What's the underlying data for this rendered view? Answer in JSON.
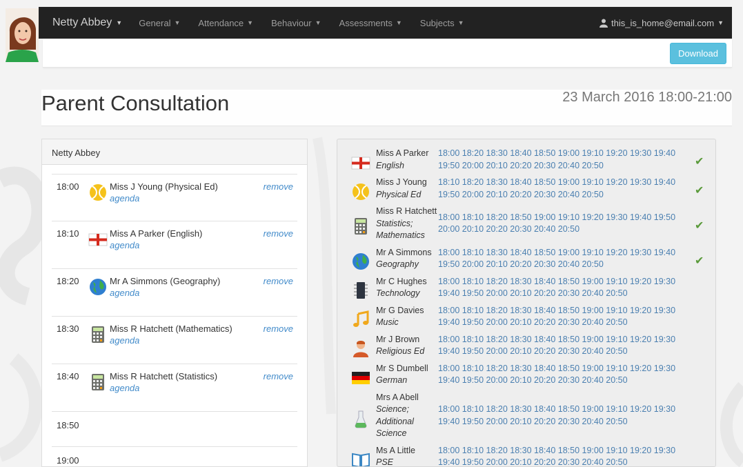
{
  "nav": {
    "brand": "Netty Abbey",
    "items": [
      "General",
      "Attendance",
      "Behaviour",
      "Assessments",
      "Subjects"
    ],
    "user": "this_is_home@email.com"
  },
  "toolbar": {
    "download_label": "Download"
  },
  "header": {
    "title": "Parent Consultation",
    "date": "23 March 2016 18:00-21:00"
  },
  "schedule": {
    "student": "Netty Abbey",
    "agenda_label": "agenda",
    "remove_label": "remove",
    "slots": [
      {
        "time": "18:00",
        "teacher": "Miss J Young (Physical Ed)",
        "icon": "tennis-ball-icon"
      },
      {
        "time": "18:10",
        "teacher": "Miss A Parker (English)",
        "icon": "england-flag-icon"
      },
      {
        "time": "18:20",
        "teacher": "Mr A Simmons (Geography)",
        "icon": "globe-icon"
      },
      {
        "time": "18:30",
        "teacher": "Miss R Hatchett (Mathematics)",
        "icon": "calculator-icon"
      },
      {
        "time": "18:40",
        "teacher": "Miss R Hatchett (Statistics)",
        "icon": "calculator-icon"
      },
      {
        "time": "18:50"
      },
      {
        "time": "19:00"
      }
    ]
  },
  "teachers": [
    {
      "name": "Miss A Parker",
      "subject": [
        "English"
      ],
      "slots": [
        "18:00 18:20 18:30 18:40 18:50 19:00 19:10 19:20 19:30 19:40",
        "19:50 20:00 20:10 20:20 20:30 20:40 20:50"
      ],
      "booked": true,
      "icon": "england-flag-icon"
    },
    {
      "name": "Miss J Young",
      "subject": [
        "Physical Ed"
      ],
      "slots": [
        "18:10 18:20 18:30 18:40 18:50 19:00 19:10 19:20 19:30 19:40",
        "19:50 20:00 20:10 20:20 20:30 20:40 20:50"
      ],
      "booked": true,
      "icon": "tennis-ball-icon"
    },
    {
      "name": "Miss R Hatchett",
      "subject": [
        "Statistics;",
        "Mathematics"
      ],
      "slots": [
        "18:00 18:10 18:20 18:50 19:00 19:10 19:20 19:30 19:40 19:50",
        "20:00 20:10 20:20 20:30 20:40 20:50"
      ],
      "booked": true,
      "icon": "calculator-icon"
    },
    {
      "name": "Mr A Simmons",
      "subject": [
        "Geography"
      ],
      "slots": [
        "18:00 18:10 18:30 18:40 18:50 19:00 19:10 19:20 19:30 19:40",
        "19:50 20:00 20:10 20:20 20:30 20:40 20:50"
      ],
      "booked": true,
      "icon": "globe-icon"
    },
    {
      "name": "Mr C Hughes",
      "subject": [
        "Technology"
      ],
      "slots": [
        "18:00 18:10 18:20 18:30 18:40 18:50 19:00 19:10 19:20 19:30",
        "19:40 19:50 20:00 20:10 20:20 20:30 20:40 20:50"
      ],
      "booked": false,
      "icon": "chip-icon"
    },
    {
      "name": "Mr G Davies",
      "subject": [
        "Music"
      ],
      "slots": [
        "18:00 18:10 18:20 18:30 18:40 18:50 19:00 19:10 19:20 19:30",
        "19:40 19:50 20:00 20:10 20:20 20:30 20:40 20:50"
      ],
      "booked": false,
      "icon": "music-note-icon"
    },
    {
      "name": "Mr J Brown",
      "subject": [
        "Religious Ed"
      ],
      "slots": [
        "18:00 18:10 18:20 18:30 18:40 18:50 19:00 19:10 19:20 19:30",
        "19:40 19:50 20:00 20:10 20:20 20:30 20:40 20:50"
      ],
      "booked": false,
      "icon": "person-icon"
    },
    {
      "name": "Mr S Dumbell",
      "subject": [
        "German"
      ],
      "slots": [
        "18:00 18:10 18:20 18:30 18:40 18:50 19:00 19:10 19:20 19:30",
        "19:40 19:50 20:00 20:10 20:20 20:30 20:40 20:50"
      ],
      "booked": false,
      "icon": "germany-flag-icon"
    },
    {
      "name": "Mrs A Abell",
      "subject": [
        "Science;",
        "Additional",
        "Science"
      ],
      "slots": [
        "18:00 18:10 18:20 18:30 18:40 18:50 19:00 19:10 19:20 19:30",
        "19:40 19:50 20:00 20:10 20:20 20:30 20:40 20:50"
      ],
      "booked": false,
      "icon": "flask-icon"
    },
    {
      "name": "Ms A Little",
      "subject": [
        "PSE"
      ],
      "slots": [
        "18:00 18:10 18:20 18:30 18:40 18:50 19:00 19:10 19:20 19:30",
        "19:40 19:50 20:00 20:10 20:20 20:30 20:40 20:50"
      ],
      "booked": false,
      "icon": "book-icon"
    }
  ],
  "check_glyph": "✔",
  "colors": {
    "navbar": "#222222",
    "link": "#428bca",
    "download": "#5bc0de",
    "check": "#5a9a3a"
  }
}
